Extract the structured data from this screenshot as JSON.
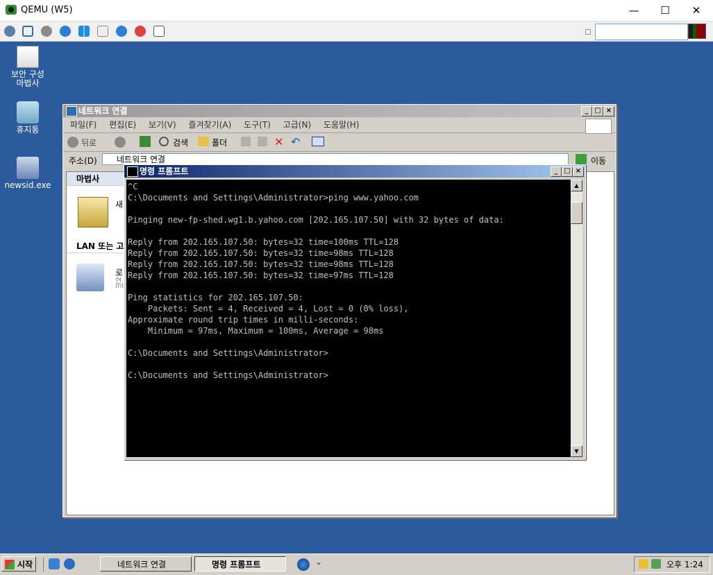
{
  "qemu": {
    "title": "QEMU (W5)",
    "toolbar_icons": [
      "cluster-icon",
      "fullscreen-icon",
      "settings-icon",
      "refresh-icon",
      "windows-icon",
      "usb-icon",
      "info-icon",
      "power-icon",
      "removable-icon"
    ],
    "input_value": ""
  },
  "desktop": {
    "icons": [
      {
        "label": "보안 구성\n마법사"
      },
      {
        "label": "휴지통"
      },
      {
        "label": "newsid.exe"
      }
    ]
  },
  "net_window": {
    "title": "네트워크 연결",
    "menu": [
      "파일(F)",
      "편집(E)",
      "보기(V)",
      "즐겨찾기(A)",
      "도구(T)",
      "고급(N)",
      "도움말(H)"
    ],
    "toolbar": {
      "back": "뒤로",
      "search": "검색",
      "folders": "폴더"
    },
    "address_label": "주소(D)",
    "address_value": "네트워크 연결",
    "go_label": "이동",
    "sections": [
      {
        "header": "마법사",
        "item_text": "새"
      },
      {
        "header": "LAN 또는 고",
        "item_text": "로",
        "item_sub1": "연",
        "item_sub2": "Int"
      }
    ]
  },
  "cmd_window": {
    "title": "명령 프롬프트",
    "output": "^C\nC:\\Documents and Settings\\Administrator>ping www.yahoo.com\n\nPinging new-fp-shed.wg1.b.yahoo.com [202.165.107.50] with 32 bytes of data:\n\nReply from 202.165.107.50: bytes=32 time=100ms TTL=128\nReply from 202.165.107.50: bytes=32 time=98ms TTL=128\nReply from 202.165.107.50: bytes=32 time=98ms TTL=128\nReply from 202.165.107.50: bytes=32 time=97ms TTL=128\n\nPing statistics for 202.165.107.50:\n    Packets: Sent = 4, Received = 4, Lost = 0 (0% loss),\nApproximate round trip times in milli-seconds:\n    Minimum = 97ms, Maximum = 100ms, Average = 98ms\n\nC:\\Documents and Settings\\Administrator>\n\nC:\\Documents and Settings\\Administrator>"
  },
  "taskbar": {
    "start_label": "시작",
    "tasks": [
      {
        "label": "네트워크 연결",
        "active": false
      },
      {
        "label": "명령 프롬프트",
        "active": true
      }
    ],
    "clock": "오후 1:24"
  }
}
